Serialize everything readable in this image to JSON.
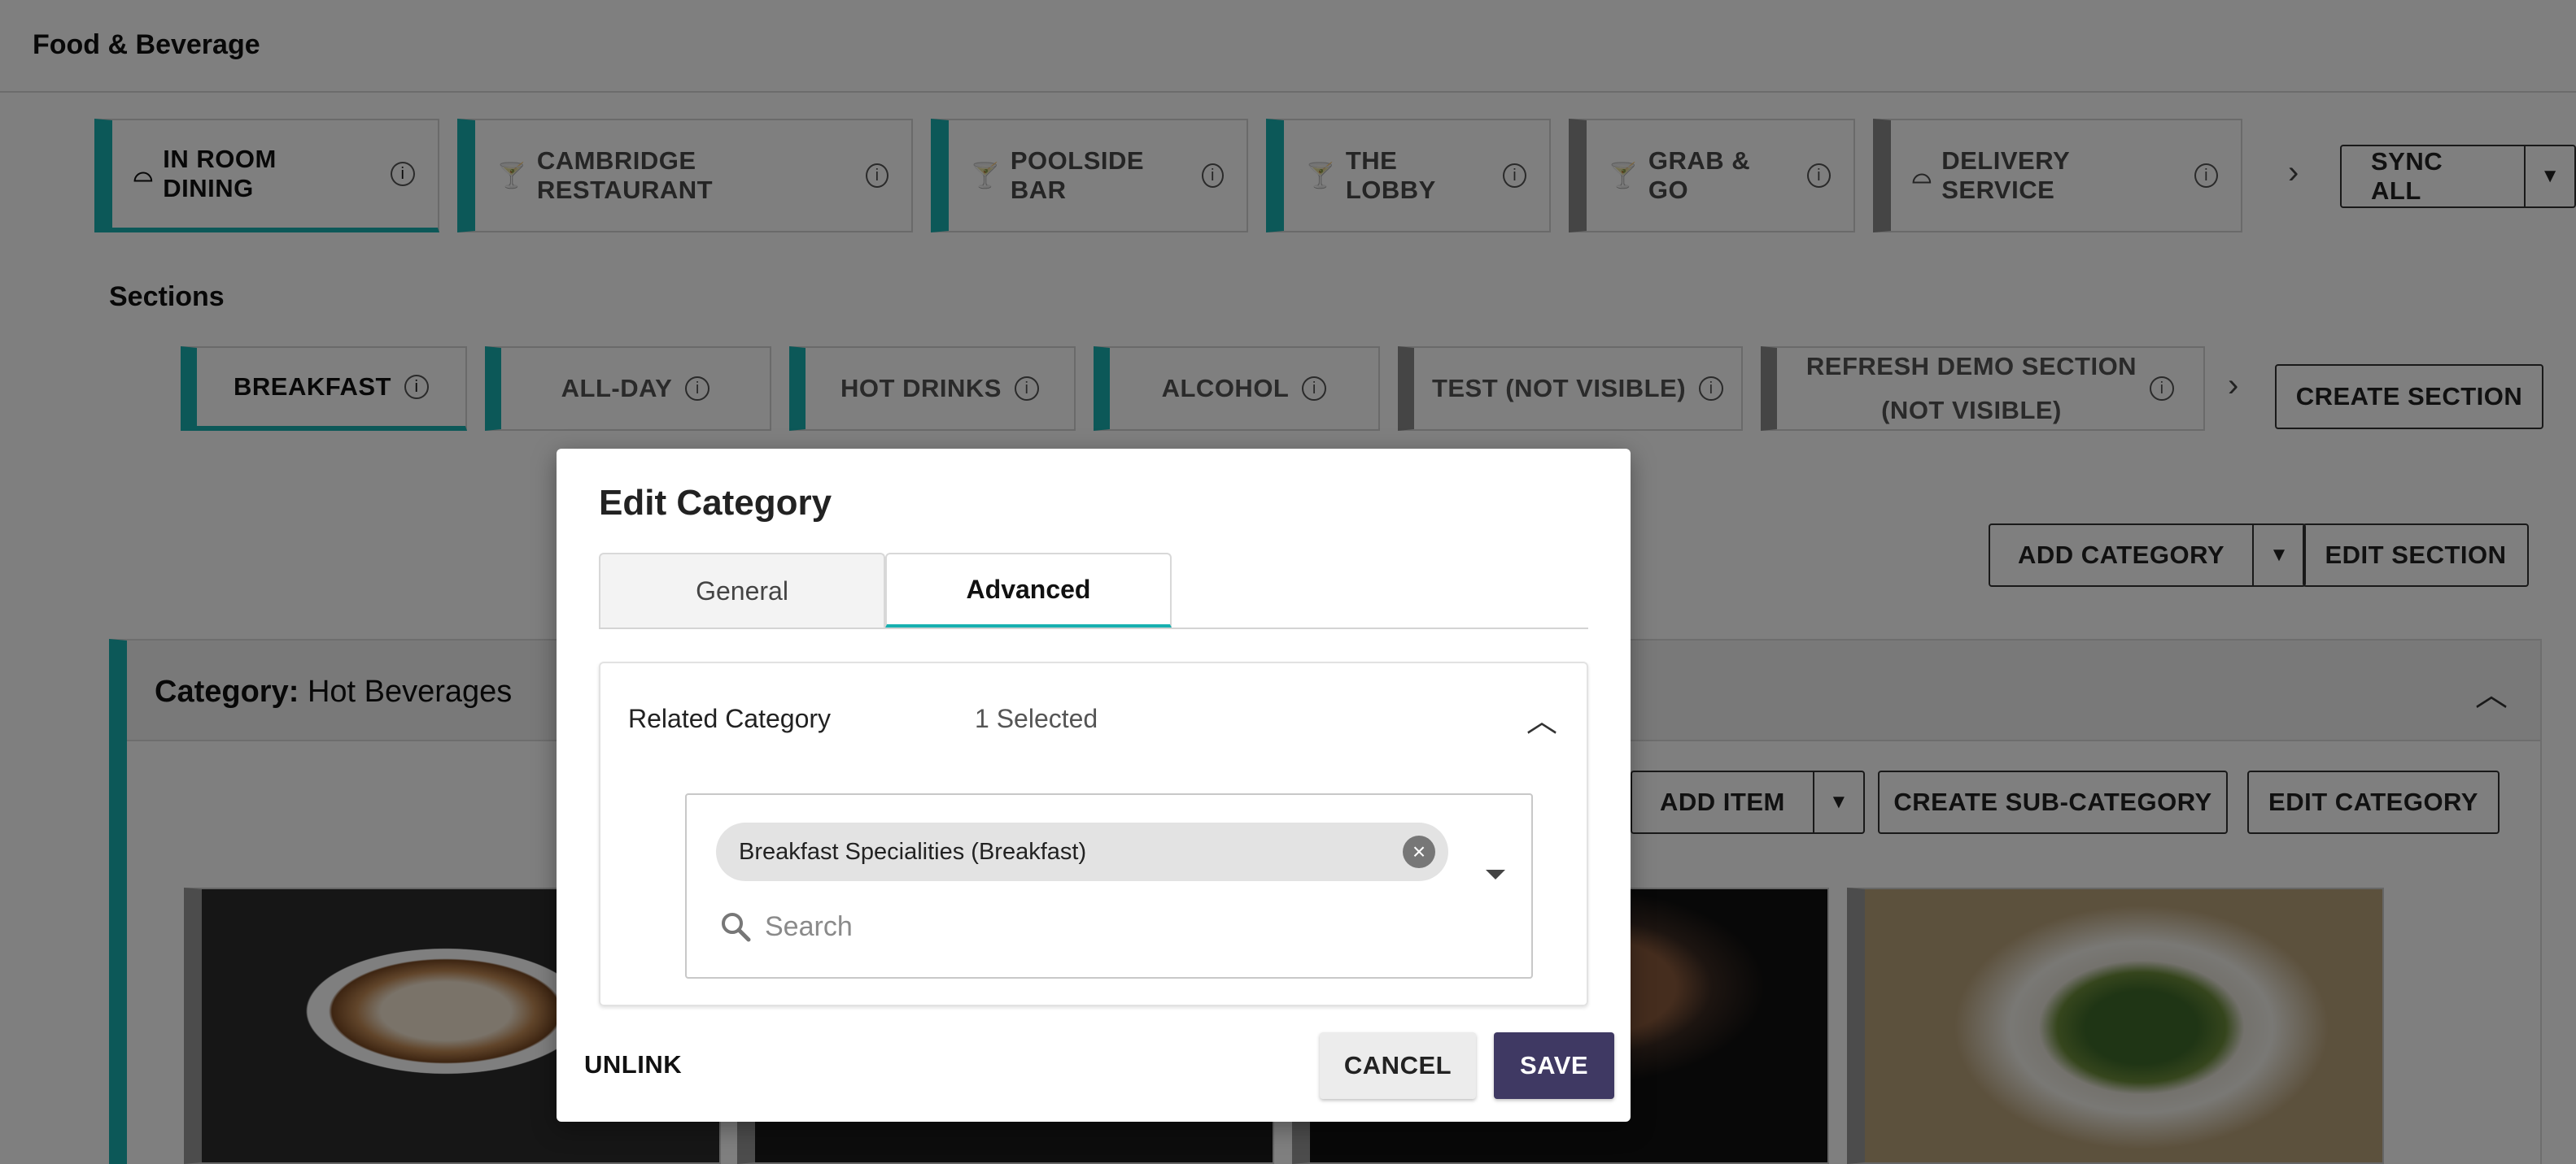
{
  "app": {
    "title": "Food & Beverage"
  },
  "outlets": [
    {
      "label": "IN ROOM DINING",
      "icon": "cloche-icon"
    },
    {
      "label": "CAMBRIDGE RESTAURANT",
      "icon": "cocktail-icon"
    },
    {
      "label": "POOLSIDE BAR",
      "icon": "cocktail-icon"
    },
    {
      "label": "THE LOBBY",
      "icon": "cocktail-icon"
    },
    {
      "label": "GRAB & GO",
      "icon": "cocktail-icon"
    },
    {
      "label": "DELIVERY SERVICE",
      "icon": "cloche-icon"
    }
  ],
  "sync": {
    "label": "SYNC ALL"
  },
  "sections": {
    "heading": "Sections",
    "tabs": [
      {
        "line1": "BREAKFAST"
      },
      {
        "line1": "ALL-DAY"
      },
      {
        "line1": "HOT DRINKS"
      },
      {
        "line1": "ALCOHOL"
      },
      {
        "line1": "TEST (NOT VISIBLE)"
      },
      {
        "line1": "REFRESH DEMO SECTION",
        "line2": "(NOT VISIBLE)"
      }
    ],
    "create_label": "CREATE SECTION"
  },
  "toolbar": {
    "add_category": "ADD CATEGORY",
    "edit_section": "EDIT SECTION"
  },
  "category": {
    "prefix": "Category:",
    "name": "Hot Beverages",
    "add_item": "ADD ITEM",
    "create_sub": "CREATE SUB-CATEGORY",
    "edit_category": "EDIT CATEGORY"
  },
  "modal": {
    "title": "Edit Category",
    "tabs": {
      "general": "General",
      "advanced": "Advanced"
    },
    "related": {
      "label": "Related Category",
      "count": "1 Selected",
      "chip": "Breakfast Specialities (Breakfast)",
      "search_placeholder": "Search"
    },
    "unlink": "UNLINK",
    "cancel": "CANCEL",
    "save": "SAVE"
  },
  "colors": {
    "accent": "#18b0b0",
    "primary_button": "#3f3963",
    "inactive_tab": "#8a8a8a"
  }
}
